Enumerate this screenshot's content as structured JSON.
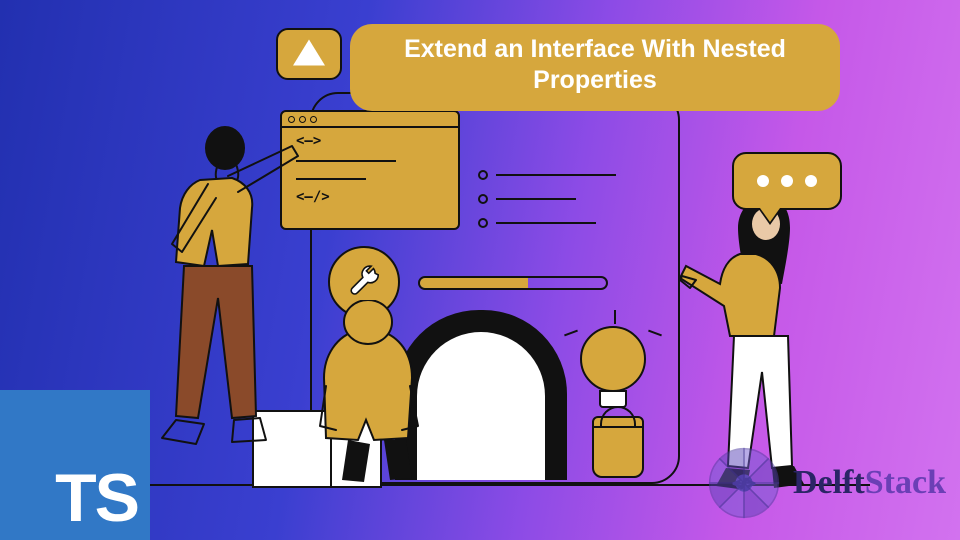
{
  "title": "Extend an Interface With Nested Properties",
  "ts_logo_text": "TS",
  "brand": {
    "name": "Delft",
    "suffix": "Stack"
  },
  "code_window": {
    "open_tag": "<—>",
    "close_tag": "<—/>"
  },
  "speech_dots": 3,
  "colors": {
    "accent": "#d6a73d",
    "ts_blue": "#3178c6",
    "delft_dark": "#2b2566",
    "delft_purple": "#6b3fb5"
  }
}
